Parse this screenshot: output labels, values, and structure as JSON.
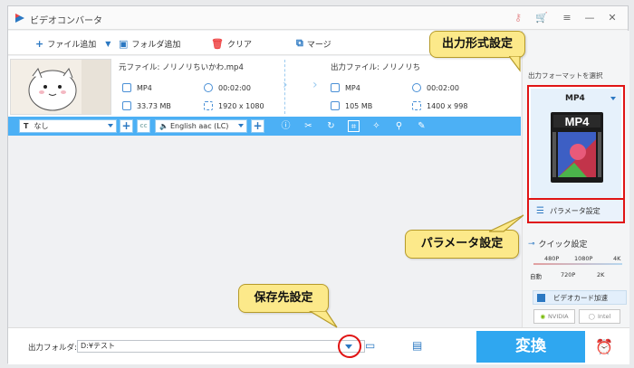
{
  "titlebar": {
    "title": "ビデオコンバータ"
  },
  "toolbar": {
    "add_file": "ファイル追加",
    "add_folder": "フォルダ追加",
    "clear": "クリア",
    "merge": "マージ"
  },
  "file": {
    "source_label": "元ファイル: ノリノリちいかわ.mp4",
    "output_label": "出力ファイル: ノリノリち",
    "src_format": "MP4",
    "src_duration": "00:02:00",
    "src_size": "33.73 MB",
    "src_resolution": "1920 x 1080",
    "out_format": "MP4",
    "out_duration": "00:02:00",
    "out_size": "105 MB",
    "out_resolution": "1400 x 998"
  },
  "editbar": {
    "subtitle": "なし",
    "audio": "English aac (LC)"
  },
  "right_panel": {
    "select_format": "出力フォーマットを選択",
    "format_name": "MP4",
    "format_icon_text": "MP4",
    "param_button": "パラメータ設定",
    "quick_label": "クイック設定",
    "quick_top": [
      "480P",
      "1080P",
      "4K"
    ],
    "quick_bottom": [
      "自動",
      "720P",
      "2K"
    ],
    "gpu_label": "ビデオカード加速",
    "nvidia": "NVIDIA",
    "intel": "Intel"
  },
  "bottom": {
    "output_folder_label": "出力フォルダ:",
    "output_path": "D:¥テスト",
    "convert_button": "変換"
  },
  "callouts": {
    "format": "出力形式設定",
    "params": "パラメータ設定",
    "save": "保存先設定"
  }
}
